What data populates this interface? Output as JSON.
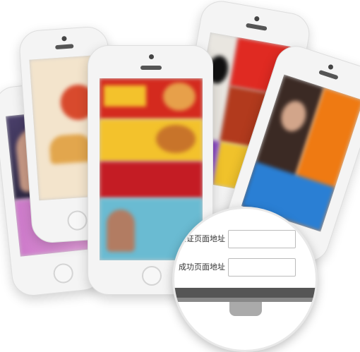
{
  "form": {
    "auth_page_label": "认证页面地址",
    "auth_page_value": "",
    "success_page_label": "成功页面地址",
    "success_page_value": ""
  },
  "colors": {
    "phone_body": "#f4f4f4",
    "banner_red": "#d42a1e",
    "banner_yellow": "#f3c22c",
    "banner_orange": "#ef7a12",
    "banner_purple": "#8a4fb9"
  },
  "icons": [
    "speaker-icon",
    "camera-icon",
    "home-button-icon"
  ]
}
